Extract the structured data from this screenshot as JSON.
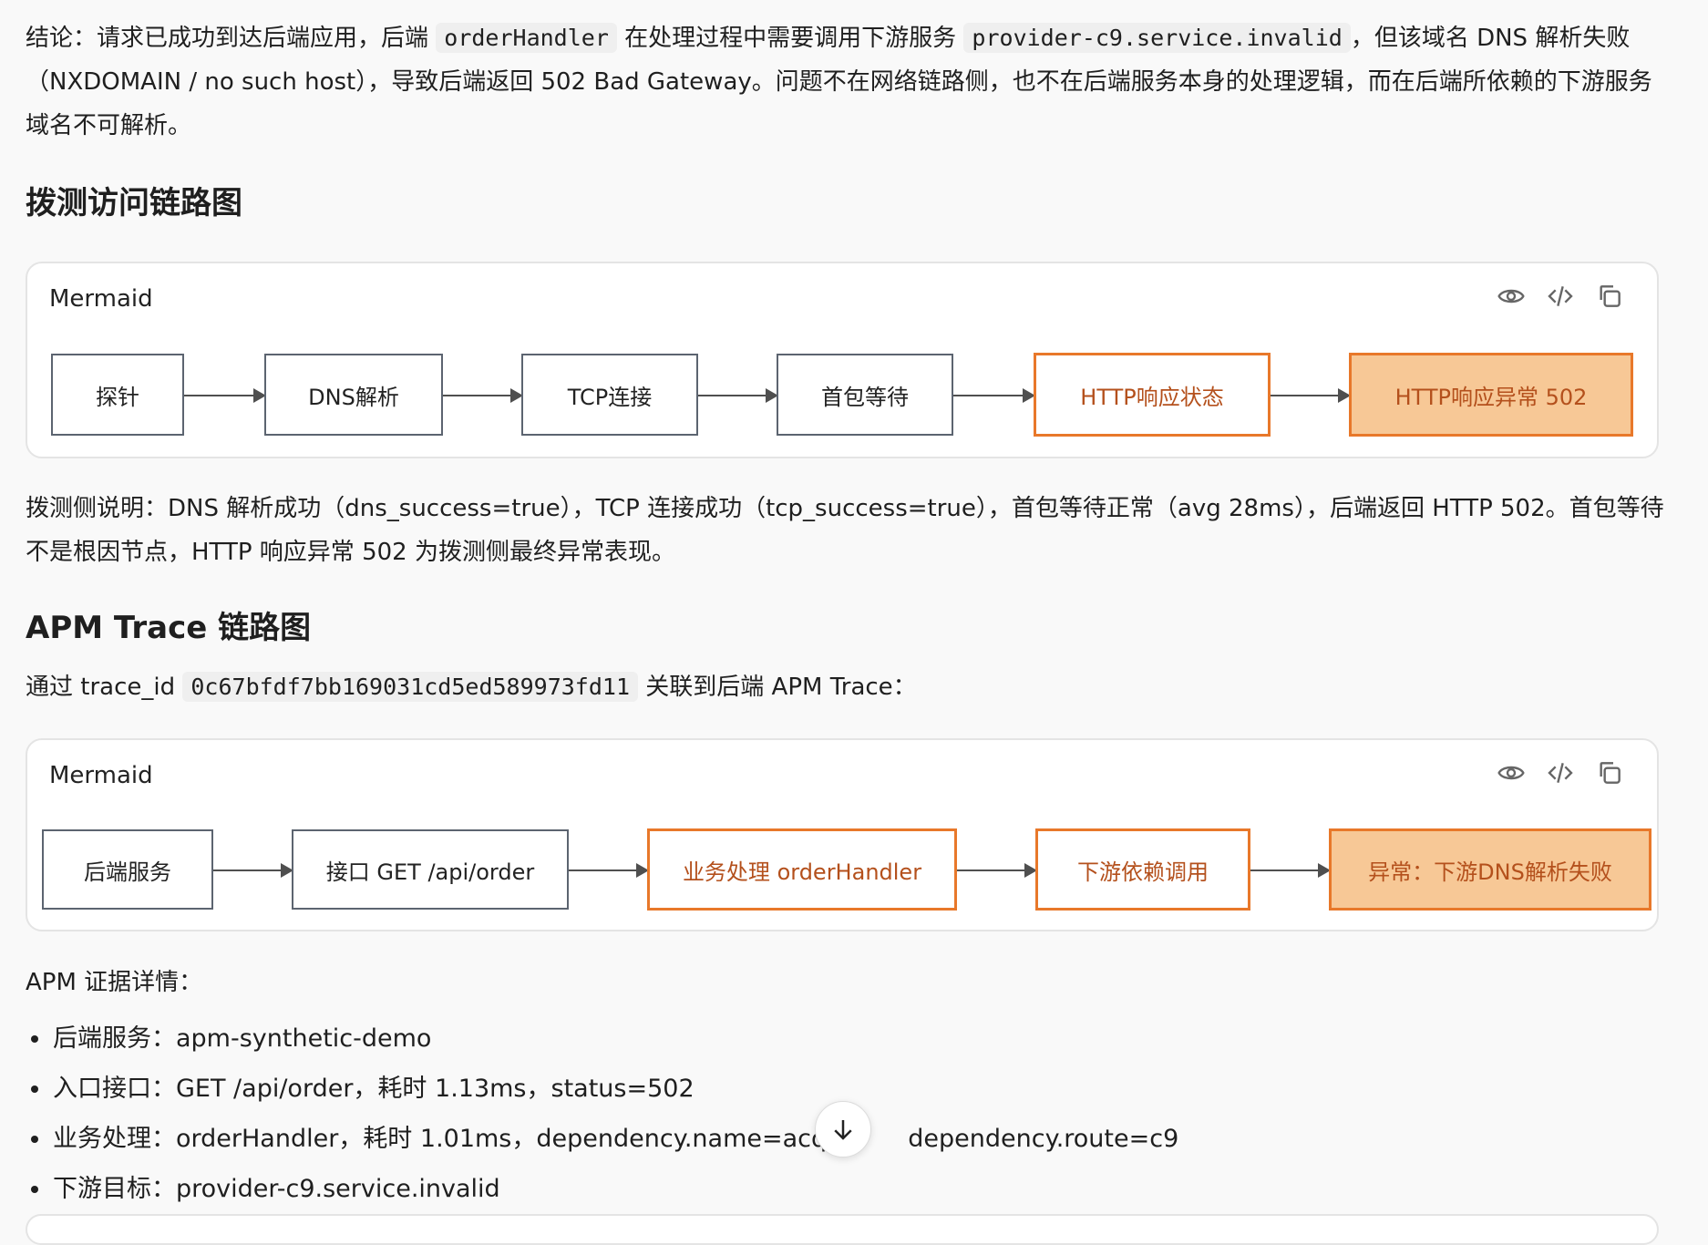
{
  "conclusion": {
    "t1": "结论：请求已成功到达后端应用，后端 ",
    "code1": "orderHandler",
    "t2": " 在处理过程中需要调用下游服务 ",
    "code2": "provider-c9.service.invalid",
    "t3": "，但该域名 DNS 解析失败（NXDOMAIN / no such host），导致后端返回 502 Bad Gateway。问题不在网络链路侧，也不在后端服务本身的处理逻辑，而在后端所依赖的下游服务域名不可解析。"
  },
  "section1": {
    "heading": "拨测访问链路图",
    "card_title": "Mermaid",
    "nodes": [
      "探针",
      "DNS解析",
      "TCP连接",
      "首包等待",
      "HTTP响应状态",
      "HTTP响应异常 502"
    ]
  },
  "probe_note": "拨测侧说明：DNS 解析成功（dns_success=true），TCP 连接成功（tcp_success=true），首包等待正常（avg 28ms），后端返回 HTTP 502。首包等待不是根因节点，HTTP 响应异常 502 为拨测侧最终异常表现。",
  "section2": {
    "heading": "APM Trace 链路图",
    "intro_prefix": "通过 trace_id ",
    "trace_id": "0c67bfdf7bb169031cd5ed589973fd11",
    "intro_suffix": " 关联到后端 APM Trace：",
    "card_title": "Mermaid",
    "nodes": [
      "后端服务",
      "接口 GET /api/order",
      "业务处理 orderHandler",
      "下游依赖调用",
      "异常：下游DNS解析失败"
    ]
  },
  "evidence": {
    "title": "APM 证据详情：",
    "items": [
      "后端服务：apm-synthetic-demo",
      "入口接口：GET /api/order，耗时 1.13ms，status=502",
      "业务处理：orderHandler，耗时 1.01ms，dependency.name=acqu",
      "下游目标：provider-c9.service.invalid"
    ],
    "item3_tail": "dependency.route=c9"
  },
  "icons": [
    "eye-icon",
    "code-icon",
    "copy-icon",
    "arrow-down-icon"
  ],
  "colors": {
    "accent": "#e8782a",
    "error_fill": "#f7c896",
    "error_text": "#b4501c"
  }
}
